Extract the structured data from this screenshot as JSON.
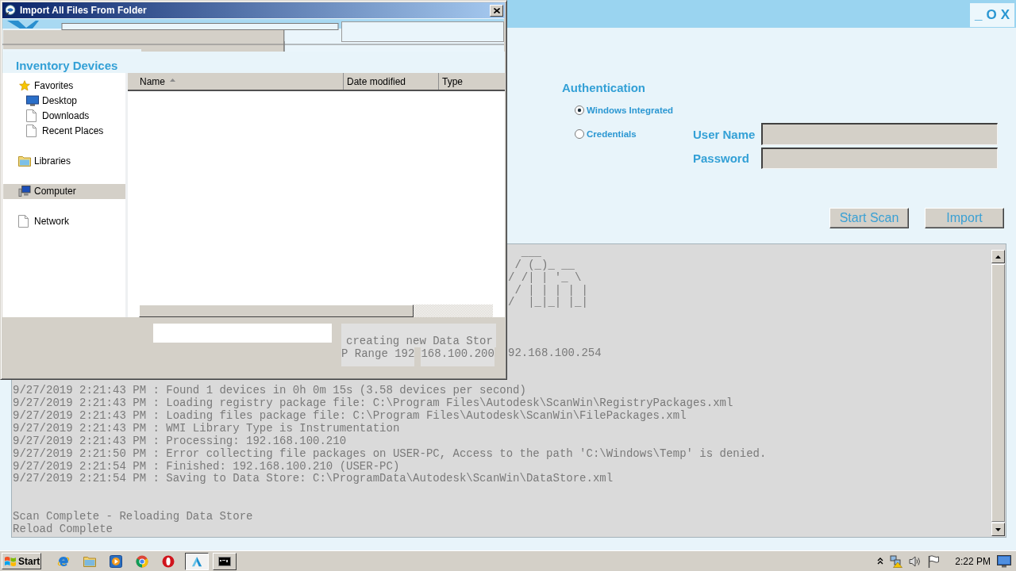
{
  "app": {
    "window_controls": [
      "_",
      "O",
      "X"
    ]
  },
  "authentication": {
    "title": "Authentication",
    "options": [
      {
        "label": "Windows Integrated",
        "selected": true
      },
      {
        "label": "Credentials",
        "selected": false
      }
    ],
    "fields": [
      {
        "label": "User Name"
      },
      {
        "label": "Password"
      }
    ]
  },
  "buttons": [
    "Start Scan",
    "Import"
  ],
  "log": {
    "beside_dialog": [
      {
        "lines": [
          "  ___",
          " / (_)_ __",
          "/ /| | '_ \\",
          " / | | | | |",
          "/  |_|_| |_|"
        ]
      },
      {
        "lines": [
          "92.168.100.254"
        ]
      }
    ],
    "below_dialog": [
      {
        "lines": [
          "9/27/2019 2:21:43 PM : Found 1 devices in 0h 0m 15s (3.58 devices per second)",
          "9/27/2019 2:21:43 PM : Loading registry package file: C:\\Program Files\\Autodesk\\ScanWin\\RegistryPackages.xml",
          "9/27/2019 2:21:43 PM : Loading files package file: C:\\Program Files\\Autodesk\\ScanWin\\FilePackages.xml",
          "9/27/2019 2:21:43 PM : WMI Library Type is Instrumentation",
          "9/27/2019 2:21:43 PM : Processing: 192.168.100.210",
          "9/27/2019 2:21:50 PM : Error collecting file packages on USER-PC, Access to the path 'C:\\Windows\\Temp' is denied.",
          "9/27/2019 2:21:54 PM : Finished: 192.168.100.210 (USER-PC)",
          "9/27/2019 2:21:54 PM : Saving to Data Store: C:\\ProgramData\\Autodesk\\ScanWin\\DataStore.xml"
        ]
      },
      {
        "lines": [
          "Scan Complete - Reloading Data Store",
          "Reload Complete"
        ]
      }
    ]
  },
  "dialog": {
    "title": "Import All Files From Folder",
    "see_through": {
      "heading": "Inventory Devices",
      "log_fragments": [
        "creating new Data Stor",
        "P Range 192",
        "168.100.200"
      ]
    },
    "nav": [
      {
        "label": "Favorites",
        "kind": "star",
        "selected": false,
        "children": [
          {
            "label": "Desktop",
            "kind": "desktop",
            "selected": false
          },
          {
            "label": "Downloads",
            "kind": "page",
            "selected": false
          },
          {
            "label": "Recent Places",
            "kind": "page",
            "selected": false
          }
        ]
      },
      {
        "label": "Libraries",
        "kind": "library",
        "selected": false
      },
      {
        "label": "Computer",
        "kind": "computer",
        "selected": true
      },
      {
        "label": "Network",
        "kind": "page",
        "selected": false
      }
    ],
    "columns": [
      {
        "label": "Name",
        "sorted": true
      },
      {
        "label": "Date modified",
        "sorted": false
      },
      {
        "label": "Type",
        "sorted": false
      }
    ]
  },
  "taskbar": {
    "start": "Start",
    "task_buttons": [
      {
        "kind": "app",
        "selected": true
      },
      {
        "kind": "console",
        "selected": false
      }
    ],
    "clock": "2:22 PM"
  }
}
